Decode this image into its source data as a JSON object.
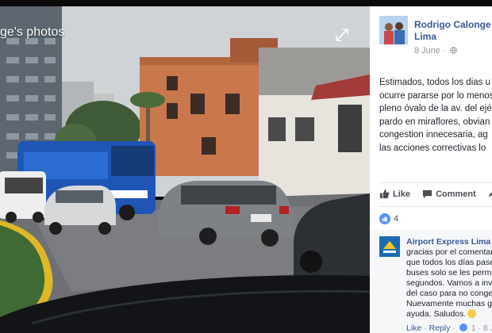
{
  "viewer": {
    "title": "ge's photos"
  },
  "post": {
    "author": "Rodrigo Calonge Lima",
    "date": "8 June",
    "separator": "·",
    "text_lines": [
      "Estimados, todos los dias u",
      "ocurre pararse por lo menos",
      "pleno óvalo de la av. del ejé",
      "pardo en miraflores, obvian",
      "congestion innecesaria, ag",
      "las acciones correctivas lo"
    ],
    "actions": {
      "like": "Like",
      "comment": "Comment"
    },
    "reaction_count": "4"
  },
  "comment": {
    "author": "Airport Express Lima",
    "author_tail": " H",
    "lines": [
      "gracias por el comentari",
      "que todos los días pase",
      "buses solo se les permit",
      "segundos. Vamos a inve",
      "del caso para no conges",
      "Nuevamente muchas gra",
      "ayuda. Saludos."
    ],
    "actions": {
      "like": "Like",
      "reply": "Reply",
      "dot": "·",
      "likes": "1",
      "date": "8 J"
    }
  },
  "colors": {
    "link": "#365899",
    "like_blue": "#5890ff",
    "bus_blue": "#1f56b6"
  }
}
